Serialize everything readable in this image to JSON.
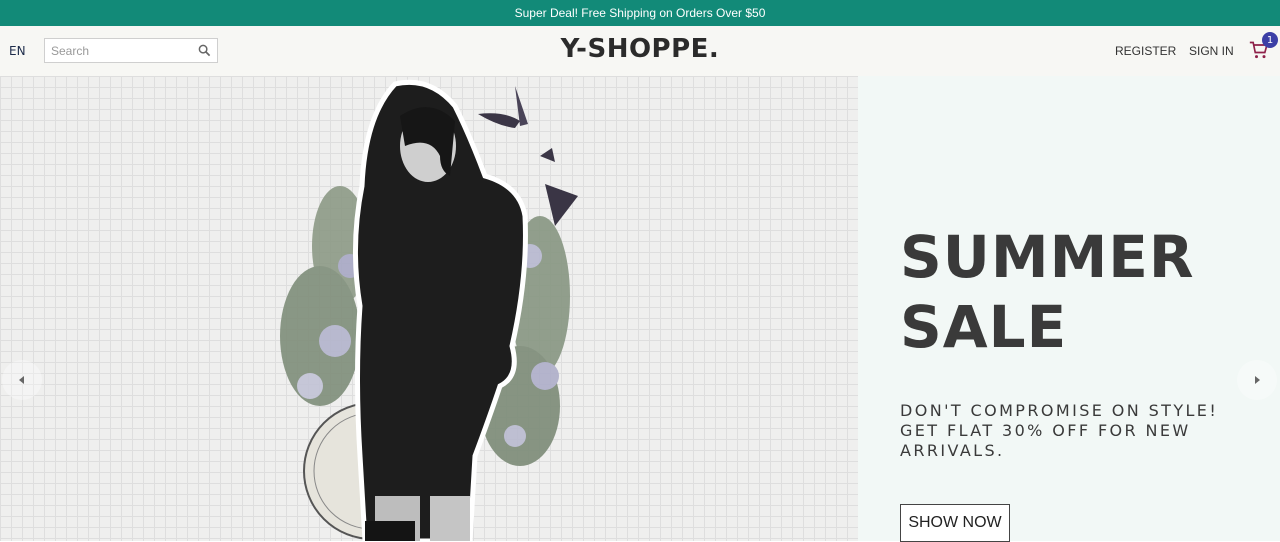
{
  "announcement": "Super Deal! Free Shipping on Orders Over $50",
  "header": {
    "language": "EN",
    "search_placeholder": "Search",
    "logo": "Y-SHOPPE.",
    "register_label": "REGISTER",
    "signin_label": "SIGN IN",
    "cart_count": "1"
  },
  "hero": {
    "headline_line1": "SUMMER",
    "headline_line2": "SALE",
    "subline": "DON'T COMPROMISE ON STYLE! GET FLAT 30% OFF FOR NEW ARRIVALS.",
    "button_label": "SHOW NOW"
  },
  "icons": {
    "search": "search-icon",
    "cart": "cart-icon",
    "prev": "arrow-left-icon",
    "next": "arrow-right-icon"
  },
  "colors": {
    "announce_bg": "#128a78",
    "cart_badge": "#3c3fa6",
    "cart_icon": "#8e2149",
    "hero_text_bg": "#f2f8f6"
  }
}
